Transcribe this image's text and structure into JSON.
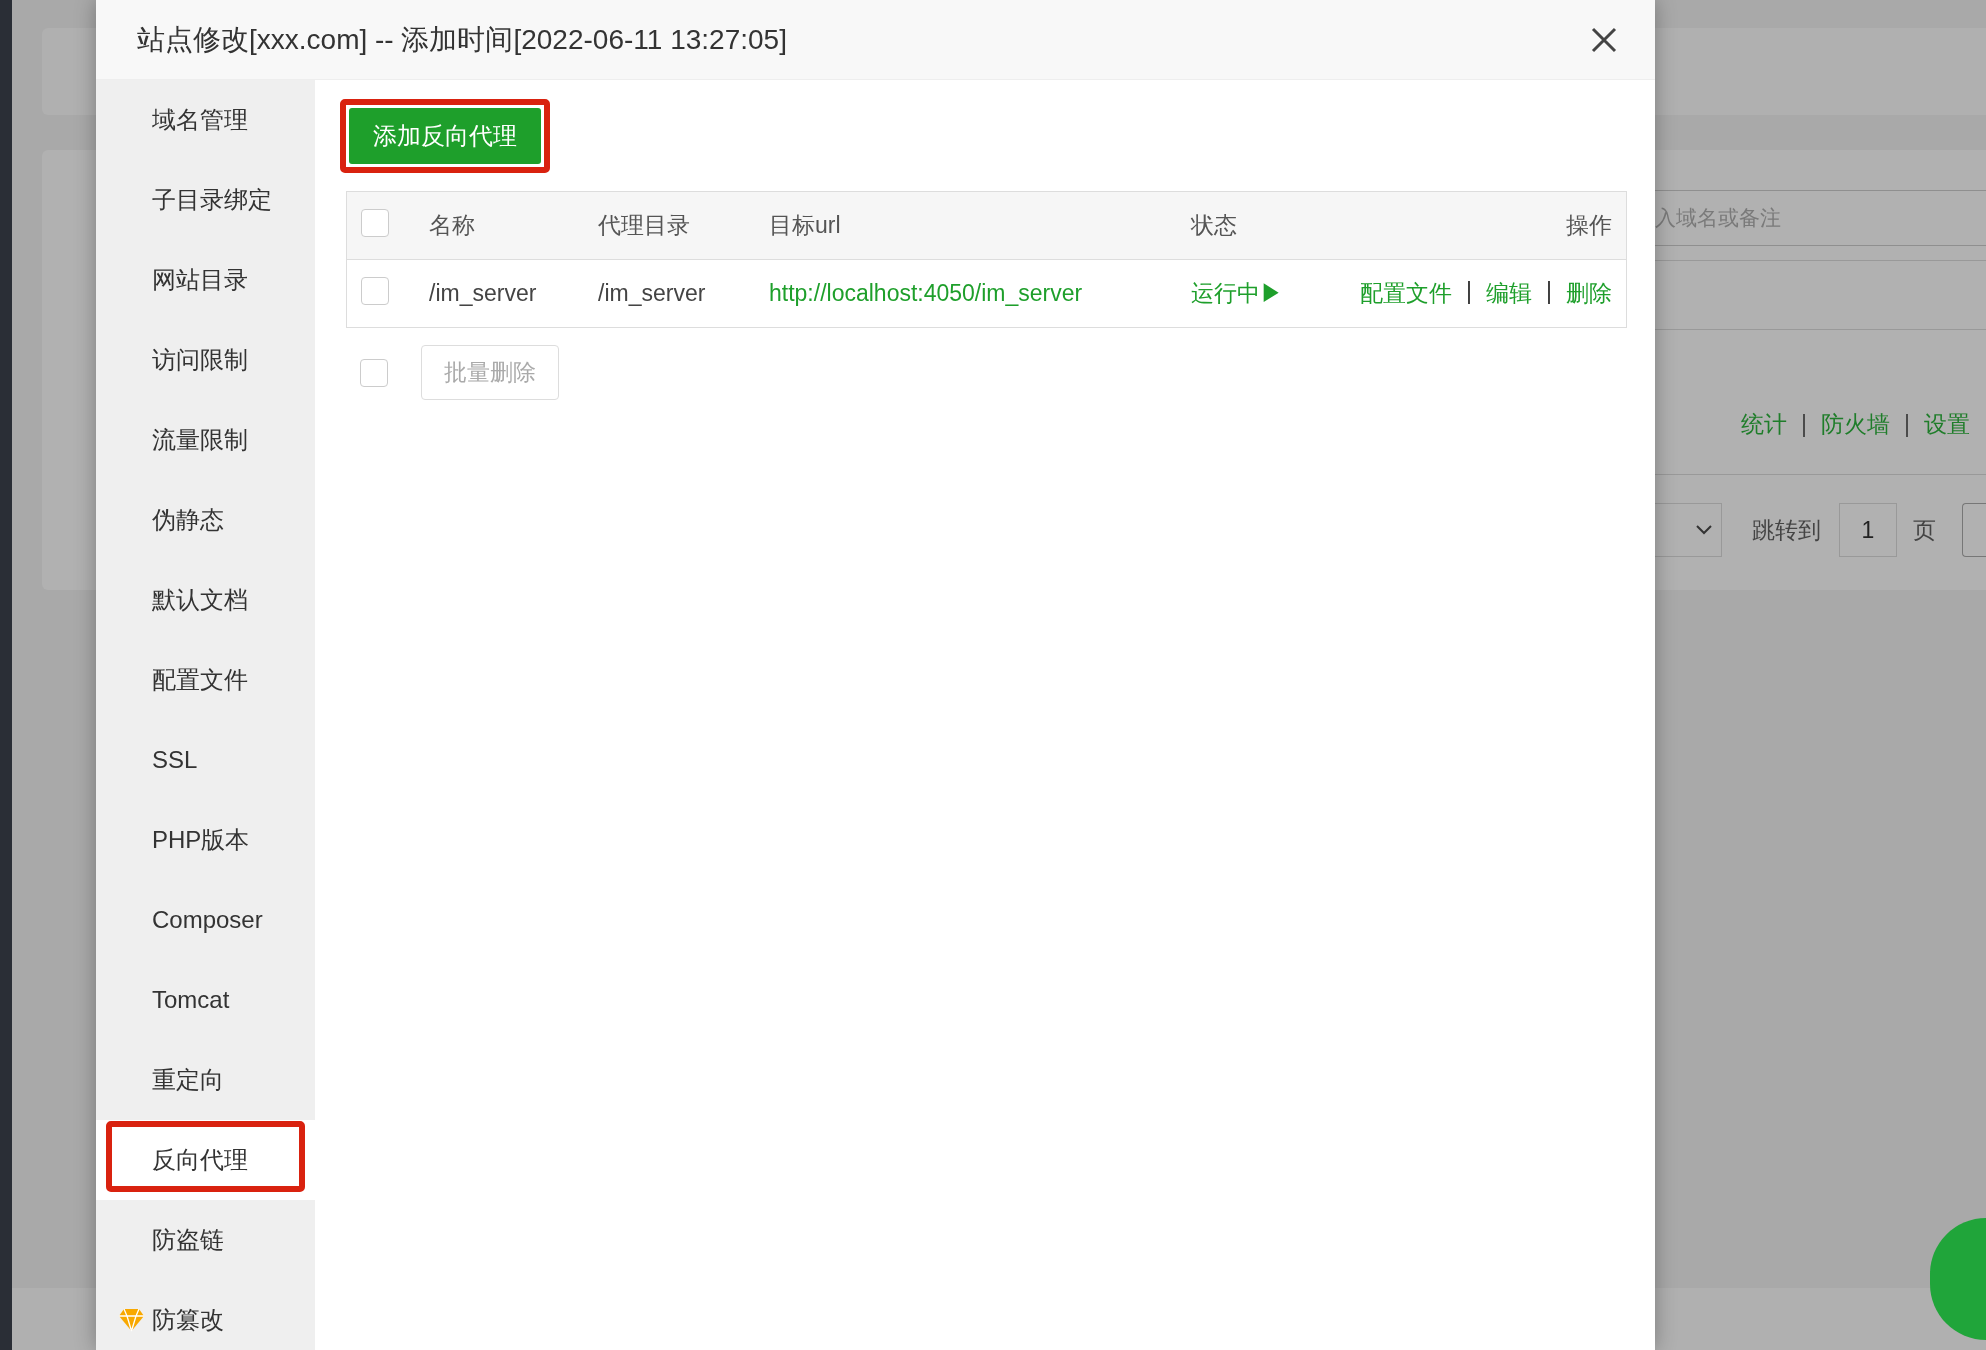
{
  "background_page": {
    "search": {
      "placeholder": "入域名或备注"
    },
    "site_links": [
      "统计",
      "防火墙",
      "设置"
    ],
    "link_separator": "|",
    "pagination": {
      "goto_label": "跳转到",
      "page_input": "1",
      "page_unit": "页"
    }
  },
  "dialog": {
    "title": "站点修改[xxx.com] -- 添加时间[2022-06-11 13:27:05]",
    "sidebar": {
      "items": [
        {
          "label": "域名管理",
          "kind": "plain",
          "selected": false,
          "highlighted": false
        },
        {
          "label": "子目录绑定",
          "kind": "plain",
          "selected": false,
          "highlighted": false
        },
        {
          "label": "网站目录",
          "kind": "plain",
          "selected": false,
          "highlighted": false
        },
        {
          "label": "访问限制",
          "kind": "plain",
          "selected": false,
          "highlighted": false
        },
        {
          "label": "流量限制",
          "kind": "plain",
          "selected": false,
          "highlighted": false
        },
        {
          "label": "伪静态",
          "kind": "plain",
          "selected": false,
          "highlighted": false
        },
        {
          "label": "默认文档",
          "kind": "plain",
          "selected": false,
          "highlighted": false
        },
        {
          "label": "配置文件",
          "kind": "plain",
          "selected": false,
          "highlighted": false
        },
        {
          "label": "SSL",
          "kind": "plain",
          "selected": false,
          "highlighted": false
        },
        {
          "label": "PHP版本",
          "kind": "plain",
          "selected": false,
          "highlighted": false
        },
        {
          "label": "Composer",
          "kind": "plain",
          "selected": false,
          "highlighted": false
        },
        {
          "label": "Tomcat",
          "kind": "plain",
          "selected": false,
          "highlighted": false
        },
        {
          "label": "重定向",
          "kind": "plain",
          "selected": false,
          "highlighted": false
        },
        {
          "label": "反向代理",
          "kind": "plain",
          "selected": true,
          "highlighted": true
        },
        {
          "label": "防盗链",
          "kind": "plain",
          "selected": false,
          "highlighted": false
        },
        {
          "label": "防篡改",
          "kind": "premium",
          "selected": false,
          "highlighted": false
        }
      ]
    },
    "add_button": {
      "label": "添加反向代理",
      "highlighted": true
    },
    "table": {
      "header_checked": false,
      "columns": [
        "名称",
        "代理目录",
        "目标url",
        "状态",
        "操作"
      ],
      "rows": [
        {
          "checked": false,
          "name": "/im_server",
          "directory": "/im_server",
          "url": "http://localhost:4050/im_server",
          "status": "运行中▶",
          "actions": [
            "配置文件",
            "编辑",
            "删除"
          ]
        }
      ],
      "action_separator": "|"
    },
    "batch": {
      "checked": false,
      "button": "批量删除",
      "disabled": true
    }
  }
}
